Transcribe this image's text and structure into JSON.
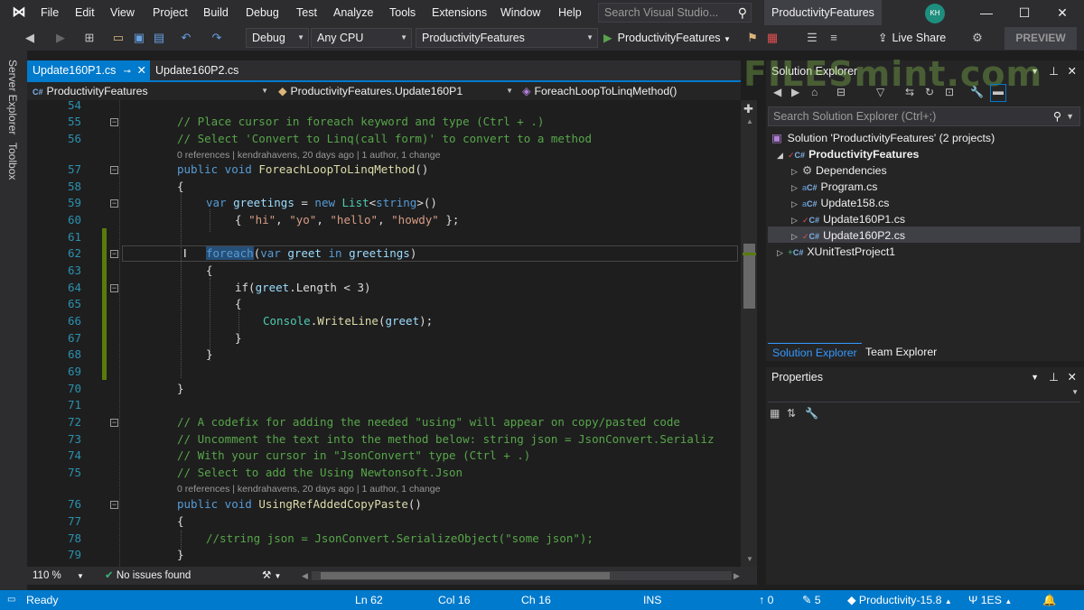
{
  "menubar": {
    "items": [
      "File",
      "Edit",
      "View",
      "Project",
      "Build",
      "Debug",
      "Test",
      "Analyze",
      "Tools",
      "Extensions",
      "Window",
      "Help"
    ],
    "search_placeholder": "Search Visual Studio...",
    "window_title": "ProductivityFeatures",
    "avatar_initials": "KH"
  },
  "toolbar": {
    "config": "Debug",
    "platform": "Any CPU",
    "project": "ProductivityFeatures",
    "start_label": "ProductivityFeatures",
    "live_share": "Live Share",
    "preview": "PREVIEW"
  },
  "left_strip": {
    "server_explorer": "Server Explorer",
    "toolbox": "Toolbox"
  },
  "tabs": [
    {
      "label": "Update160P1.cs",
      "active": true
    },
    {
      "label": "Update160P2.cs",
      "active": false
    }
  ],
  "navbar": {
    "project": "ProductivityFeatures",
    "class": "ProductivityFeatures.Update160P1",
    "member": "ForeachLoopToLinqMethod()"
  },
  "editor": {
    "line_numbers": {
      "l54": "54",
      "l55": "55",
      "l56": "56",
      "l57": "57",
      "l58": "58",
      "l59": "59",
      "l60": "60",
      "l61": "61",
      "l62": "62",
      "l63": "63",
      "l64": "64",
      "l65": "65",
      "l66": "66",
      "l67": "67",
      "l68": "68",
      "l69": "69",
      "l70": "70",
      "l71": "71",
      "l72": "72",
      "l73": "73",
      "l74": "74",
      "l75": "75",
      "l76": "76",
      "l77": "77",
      "l78": "78",
      "l79": "79"
    },
    "codelens_1": "0 references | kendrahavens, 20 days ago | 1 author, 1 change",
    "codelens_2": "0 references | kendrahavens, 20 days ago | 1 author, 1 change",
    "lines": {
      "c55": "// Place cursor in foreach keyword and type (Ctrl + .)",
      "c56": "// Select 'Convert to Linq(call form)' to convert to a method",
      "c57_kw": "public void ",
      "c57_fn": "ForeachLoopToLinqMethod",
      "c57_rest": "()",
      "c58": "{",
      "c59_kw": "var ",
      "c59_var": "greetings",
      "c59_op": " = ",
      "c59_new": "new ",
      "c59_typ": "List",
      "c59_lt": "<",
      "c59_str": "string",
      "c59_end": ">()",
      "c60_open": "{ ",
      "c60_s1": "\"hi\"",
      "c60_s2": "\"yo\"",
      "c60_s3": "\"hello\"",
      "c60_s4": "\"howdy\"",
      "c60_close": " };",
      "c62_kw": "foreach",
      "c62_rest1": "(",
      "c62_var": "var ",
      "c62_greet": "greet",
      "c62_in": " in ",
      "c62_greetings": "greetings",
      "c62_close": ")",
      "c63": "{",
      "c64_if": "if(",
      "c64_greet": "greet",
      "c64_rest": ".Length < 3)",
      "c65": "{",
      "c66_typ": "Console",
      "c66_dot": ".",
      "c66_fn": "WriteLine",
      "c66_open": "(",
      "c66_greet": "greet",
      "c66_close": ");",
      "c67": "}",
      "c68": "}",
      "c70": "}",
      "c72": "// A codefix for adding the needed \"using\" will appear on copy/pasted code",
      "c73": "// Uncomment the text into the method below: string json = JsonConvert.Serializ",
      "c74": "// With your cursor in \"JsonConvert\" type (Ctrl + .)",
      "c75": "// Select to add the Using Newtonsoft.Json",
      "c76_kw": "public void ",
      "c76_fn": "UsingRefAddedCopyPaste",
      "c76_rest": "()",
      "c77": "{",
      "c78": "//string json = JsonConvert.SerializeObject(\"some json\");",
      "c79": "}"
    }
  },
  "editor_footer": {
    "zoom": "110 %",
    "issues": "No issues found"
  },
  "solution_explorer": {
    "title": "Solution Explorer",
    "search_placeholder": "Search Solution Explorer (Ctrl+;)",
    "items": {
      "solution": "Solution 'ProductivityFeatures' (2 projects)",
      "project": "ProductivityFeatures",
      "dependencies": "Dependencies",
      "program": "Program.cs",
      "update158": "Update158.cs",
      "update160p1": "Update160P1.cs",
      "update160p2": "Update160P2.cs",
      "xunit": "XUnitTestProject1"
    },
    "tab_solution": "Solution Explorer",
    "tab_team": "Team Explorer"
  },
  "properties": {
    "title": "Properties"
  },
  "statusbar": {
    "ready": "Ready",
    "ln": "Ln 62",
    "col": "Col 16",
    "ch": "Ch 16",
    "ins": "INS",
    "up": "0",
    "pencil": "5",
    "branch": "Productivity-15.8",
    "repo": "1ES"
  },
  "colors": {
    "accent": "#007acc",
    "comment": "#57a64a",
    "keyword": "#569cd6",
    "string": "#d69d85",
    "type": "#4ec9b0",
    "method": "#dcdcaa",
    "variable": "#9cdcfe"
  },
  "watermark": "FILESmint.com"
}
